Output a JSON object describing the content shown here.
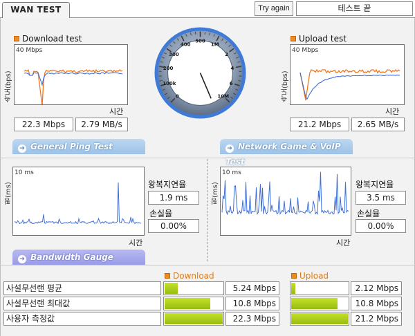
{
  "topbar": {
    "tab_label": "WAN TEST",
    "try_again_label": "Try again",
    "status_text": "테스트 끝"
  },
  "download": {
    "title": "Download test",
    "scale": "40 Mbps",
    "y_label": "속도(bps)",
    "x_label": "시간",
    "mbps": "22.3 Mbps",
    "mbs": "2.79 MB/s"
  },
  "upload": {
    "title": "Upload test",
    "scale": "40 Mbps",
    "y_label": "속도(bps)",
    "x_label": "시간",
    "mbps": "21.2 Mbps",
    "mbs": "2.65 MB/s"
  },
  "gauge": {
    "labels": [
      "0",
      "100k",
      "200",
      "300",
      "400",
      "500",
      "1M",
      "2",
      "4",
      "6",
      "10M"
    ],
    "needle_value_mbps": 22.3,
    "colors": {
      "ring": "#7d8da2",
      "face": "#ffffff",
      "tick": "#3a3a3a"
    }
  },
  "ping": {
    "banner": "General Ping Test",
    "scale": "10 ms",
    "y_label": "핑(ms)",
    "x_label": "시간",
    "rtt_label": "왕복지연율",
    "rtt_value": "1.9 ms",
    "loss_label": "손실율",
    "loss_value": "0.00%"
  },
  "game": {
    "banner": "Network Game & VoIP Test",
    "scale": "10 ms",
    "y_label": "핑(ms)",
    "x_label": "시간",
    "rtt_label": "왕복지연율",
    "rtt_value": "3.5 ms",
    "loss_label": "손실율",
    "loss_value": "0.00%"
  },
  "bandwidth": {
    "banner": "Bandwidth Gauge",
    "download_header": "Download",
    "upload_header": "Upload",
    "rows": [
      {
        "label": "사설무선랜 평균",
        "down_value": "5.24 Mbps",
        "down_fraction": 0.24,
        "up_value": "2.12 Mbps",
        "up_fraction": 0.1
      },
      {
        "label": "사설무선랜 최대값",
        "down_value": "10.8 Mbps",
        "down_fraction": 0.79,
        "up_value": "10.8 Mbps",
        "up_fraction": 0.82
      },
      {
        "label": "사용자 측정값",
        "down_value": "22.3 Mbps",
        "down_fraction": 1.0,
        "up_value": "21.2 Mbps",
        "up_fraction": 1.0
      }
    ]
  },
  "colors": {
    "orange": "#f07820",
    "blue": "#3f6fd8",
    "bar": "#a8c81c",
    "banner_blue": "#a8cbea",
    "banner_purple": "#a7a9ec"
  }
}
